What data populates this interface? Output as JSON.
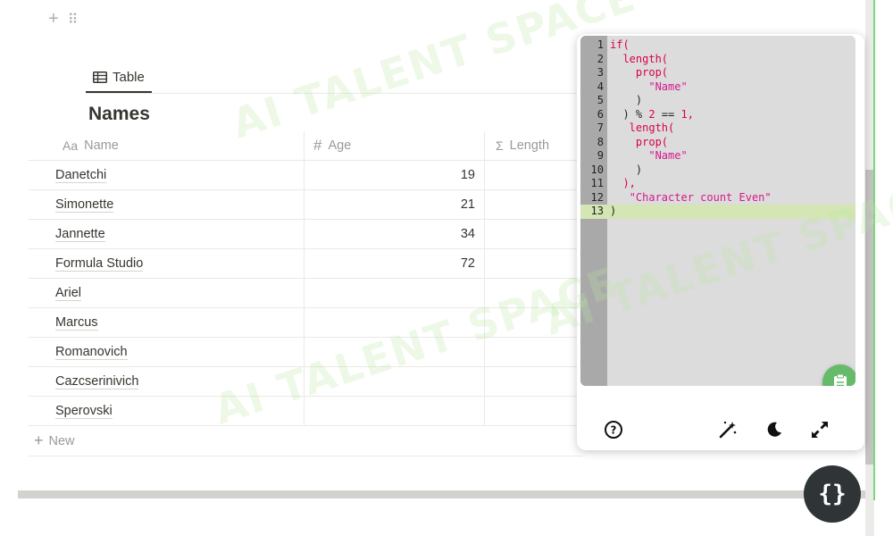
{
  "view_tab": {
    "label": "Table",
    "icon": "table-icon"
  },
  "database": {
    "title": "Names"
  },
  "columns": [
    {
      "label": "Name",
      "icon": "text-property-icon",
      "icon_text": "Aa"
    },
    {
      "label": "Age",
      "icon": "number-property-icon",
      "icon_text": "#"
    },
    {
      "label": "Length",
      "icon": "formula-property-icon",
      "icon_text": "Σ"
    }
  ],
  "rows": [
    {
      "name": "Danetchi",
      "age": "19",
      "length": ""
    },
    {
      "name": "Simonette",
      "age": "21",
      "length": ""
    },
    {
      "name": "Jannette",
      "age": "34",
      "length": ""
    },
    {
      "name": "Formula Studio",
      "age": "72",
      "length": ""
    },
    {
      "name": "Ariel",
      "age": "",
      "length": ""
    },
    {
      "name": "Marcus",
      "age": "",
      "length": ""
    },
    {
      "name": "Romanovich",
      "age": "",
      "length": ""
    },
    {
      "name": "Cazcserinivich",
      "age": "",
      "length": ""
    },
    {
      "name": "Sperovski",
      "age": "",
      "length": ""
    }
  ],
  "new_row_label": "New",
  "formula_editor": {
    "line_numbers": [
      "1",
      "2",
      "3",
      "4",
      "5",
      "6",
      "7",
      "8",
      "9",
      "10",
      "11",
      "12",
      "13"
    ],
    "lines": [
      [
        {
          "t": "if(",
          "c": "kw"
        }
      ],
      [
        {
          "t": "  length(",
          "c": "fn"
        }
      ],
      [
        {
          "t": "    prop(",
          "c": "fn"
        }
      ],
      [
        {
          "t": "      ",
          "c": "pl"
        },
        {
          "t": "\"Name\"",
          "c": "str"
        }
      ],
      [
        {
          "t": "    )",
          "c": "pl"
        }
      ],
      [
        {
          "t": "  ) % ",
          "c": "pl"
        },
        {
          "t": "2",
          "c": "num"
        },
        {
          "t": " == ",
          "c": "pl"
        },
        {
          "t": "1",
          "c": "num"
        },
        {
          "t": ",",
          "c": "fn"
        }
      ],
      [
        {
          "t": "   length(",
          "c": "fn"
        }
      ],
      [
        {
          "t": "    prop(",
          "c": "fn"
        }
      ],
      [
        {
          "t": "      ",
          "c": "pl"
        },
        {
          "t": "\"Name\"",
          "c": "str"
        }
      ],
      [
        {
          "t": "    )",
          "c": "pl"
        }
      ],
      [
        {
          "t": "  ),",
          "c": "fn"
        }
      ],
      [
        {
          "t": "   ",
          "c": "pl"
        },
        {
          "t": "\"Character count Even\"",
          "c": "str"
        }
      ],
      [
        {
          "t": ")",
          "c": "pl"
        }
      ]
    ],
    "active_line": 13
  },
  "panel_toolbar": {
    "help_icon": "help-circle-icon",
    "magic_icon": "magic-wand-icon",
    "theme_icon": "moon-icon",
    "expand_icon": "expand-icon",
    "copy_icon": "clipboard-icon"
  },
  "fab_label": "{}",
  "watermark_text": "AI TALENT SPACE",
  "colors": {
    "accent_green": "#66bb6a",
    "fab_bg": "#2f3437",
    "editor_bg": "#dcdcdc",
    "gutter_bg": "#a9a9a9"
  }
}
